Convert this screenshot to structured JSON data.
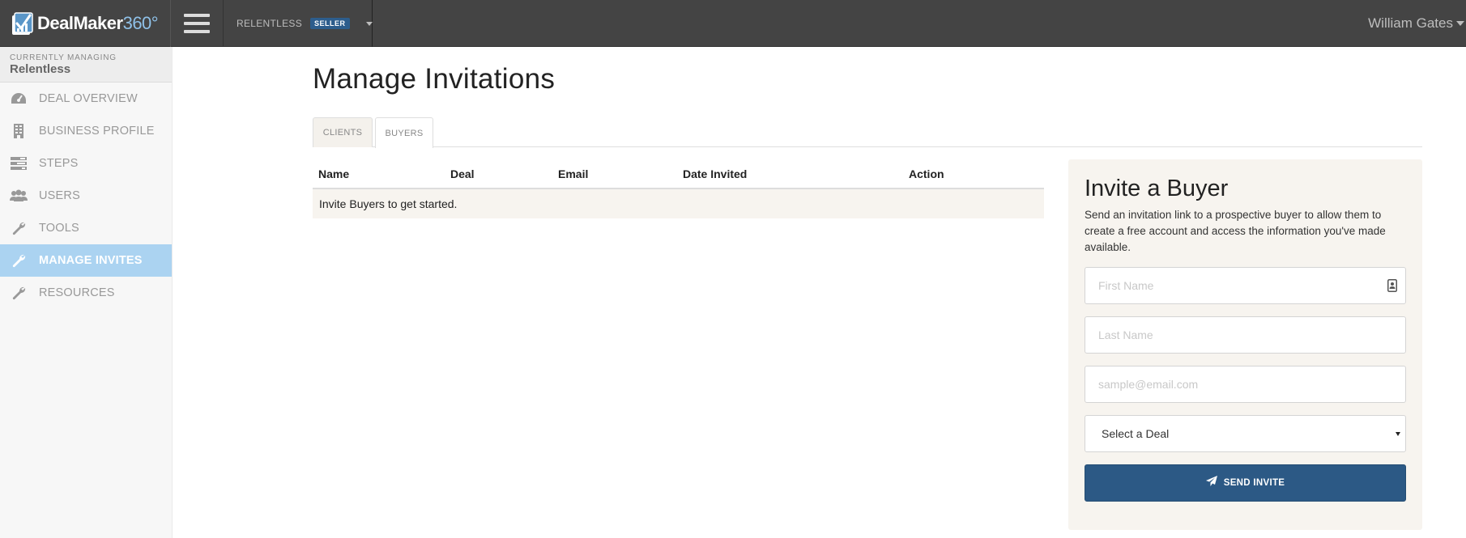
{
  "app": {
    "logo_text": "DealMaker",
    "logo_suffix": "360°"
  },
  "topbar": {
    "deal_name": "RELENTLESS",
    "deal_role_badge": "SELLER",
    "user_name": "William Gates"
  },
  "sidebar": {
    "managing_label": "CURRENTLY MANAGING",
    "managing_value": "Relentless",
    "items": [
      {
        "label": "DEAL OVERVIEW",
        "icon": "dashboard-icon",
        "active": false
      },
      {
        "label": "BUSINESS PROFILE",
        "icon": "building-icon",
        "active": false
      },
      {
        "label": "STEPS",
        "icon": "tasks-icon",
        "active": false
      },
      {
        "label": "USERS",
        "icon": "users-icon",
        "active": false
      },
      {
        "label": "TOOLS",
        "icon": "wrench-icon",
        "active": false
      },
      {
        "label": "MANAGE INVITES",
        "icon": "wrench-icon",
        "active": true
      },
      {
        "label": "RESOURCES",
        "icon": "wrench-icon",
        "active": false
      }
    ]
  },
  "main": {
    "title": "Manage Invitations",
    "tabs": [
      {
        "label": "CLIENTS",
        "active": false
      },
      {
        "label": "BUYERS",
        "active": true
      }
    ],
    "table": {
      "columns": [
        "Name",
        "Deal",
        "Email",
        "Date Invited",
        "Action"
      ],
      "empty_message": "Invite Buyers to get started."
    }
  },
  "invite_panel": {
    "title": "Invite a Buyer",
    "description": "Send an invitation link to a prospective buyer to allow them to create a free account and access the information you've made available.",
    "first_name_placeholder": "First Name",
    "last_name_placeholder": "Last Name",
    "email_placeholder": "sample@email.com",
    "deal_select_value": "Select a Deal",
    "send_button_label": "SEND INVITE"
  },
  "colors": {
    "topbar_bg": "#444444",
    "active_nav_bg": "#abd3f1",
    "primary_button": "#2c5985",
    "badge_bg": "#2d5d8c",
    "panel_bg": "#f7f4ef"
  }
}
